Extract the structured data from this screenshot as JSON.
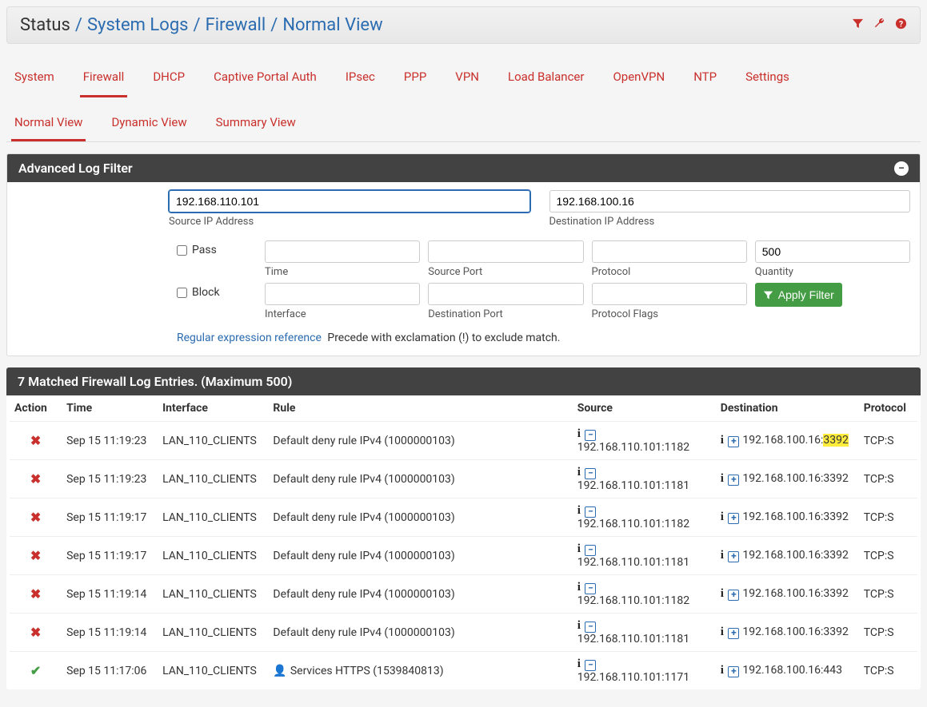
{
  "breadcrumb": {
    "root": "Status",
    "items": [
      "System Logs",
      "Firewall",
      "Normal View"
    ]
  },
  "tabs": [
    "System",
    "Firewall",
    "DHCP",
    "Captive Portal Auth",
    "IPsec",
    "PPP",
    "VPN",
    "Load Balancer",
    "OpenVPN",
    "NTP",
    "Settings"
  ],
  "active_tab": "Firewall",
  "subtabs": [
    "Normal View",
    "Dynamic View",
    "Summary View"
  ],
  "active_subtab": "Normal View",
  "filter": {
    "title": "Advanced Log Filter",
    "source_ip": {
      "value": "192.168.110.101",
      "label": "Source IP Address"
    },
    "dest_ip": {
      "value": "192.168.100.16",
      "label": "Destination IP Address"
    },
    "pass_label": "Pass",
    "block_label": "Block",
    "time_label": "Time",
    "source_port_label": "Source Port",
    "protocol_label": "Protocol",
    "quantity_label": "Quantity",
    "quantity_value": "500",
    "interface_label": "Interface",
    "dest_port_label": "Destination Port",
    "protocol_flags_label": "Protocol Flags",
    "apply_label": "Apply Filter",
    "regex_link": "Regular expression reference",
    "regex_note": "Precede with exclamation (!) to exclude match."
  },
  "results": {
    "title": "7 Matched Firewall Log Entries. (Maximum 500)",
    "columns": {
      "action": "Action",
      "time": "Time",
      "interface": "Interface",
      "rule": "Rule",
      "source": "Source",
      "destination": "Destination",
      "protocol": "Protocol"
    },
    "rows": [
      {
        "action": "block",
        "time": "Sep 15 11:19:23",
        "interface": "LAN_110_CLIENTS",
        "rule": "Default deny rule IPv4 (1000000103)",
        "source": "192.168.110.101:1182",
        "dest": "192.168.100.16:",
        "dest_port": "3392",
        "highlight_port": true,
        "proto": "TCP:S"
      },
      {
        "action": "block",
        "time": "Sep 15 11:19:23",
        "interface": "LAN_110_CLIENTS",
        "rule": "Default deny rule IPv4 (1000000103)",
        "source": "192.168.110.101:1181",
        "dest": "192.168.100.16:",
        "dest_port": "3392",
        "highlight_port": false,
        "proto": "TCP:S"
      },
      {
        "action": "block",
        "time": "Sep 15 11:19:17",
        "interface": "LAN_110_CLIENTS",
        "rule": "Default deny rule IPv4 (1000000103)",
        "source": "192.168.110.101:1182",
        "dest": "192.168.100.16:",
        "dest_port": "3392",
        "highlight_port": false,
        "proto": "TCP:S"
      },
      {
        "action": "block",
        "time": "Sep 15 11:19:17",
        "interface": "LAN_110_CLIENTS",
        "rule": "Default deny rule IPv4 (1000000103)",
        "source": "192.168.110.101:1181",
        "dest": "192.168.100.16:",
        "dest_port": "3392",
        "highlight_port": false,
        "proto": "TCP:S"
      },
      {
        "action": "block",
        "time": "Sep 15 11:19:14",
        "interface": "LAN_110_CLIENTS",
        "rule": "Default deny rule IPv4 (1000000103)",
        "source": "192.168.110.101:1182",
        "dest": "192.168.100.16:",
        "dest_port": "3392",
        "highlight_port": false,
        "proto": "TCP:S"
      },
      {
        "action": "block",
        "time": "Sep 15 11:19:14",
        "interface": "LAN_110_CLIENTS",
        "rule": "Default deny rule IPv4 (1000000103)",
        "source": "192.168.110.101:1181",
        "dest": "192.168.100.16:",
        "dest_port": "3392",
        "highlight_port": false,
        "proto": "TCP:S"
      },
      {
        "action": "pass",
        "time": "Sep 15 11:17:06",
        "interface": "LAN_110_CLIENTS",
        "rule": "Services HTTPS (1539840813)",
        "rule_icon": true,
        "source": "192.168.110.101:1171",
        "dest": "192.168.100.16:",
        "dest_port": "443",
        "highlight_port": false,
        "proto": "TCP:S"
      }
    ]
  }
}
